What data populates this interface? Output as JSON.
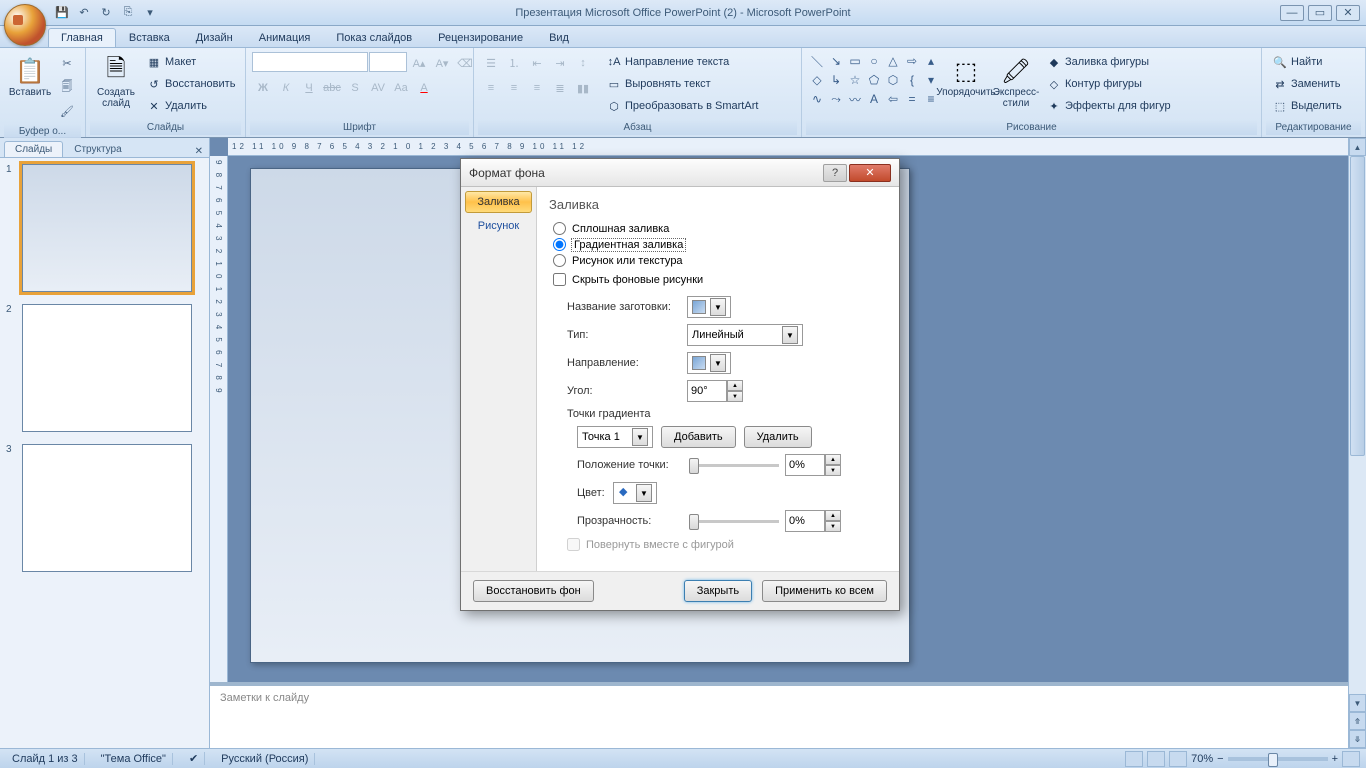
{
  "titlebar": {
    "title": "Презентация Microsoft Office PowerPoint (2) - Microsoft PowerPoint"
  },
  "tabs": {
    "home": "Главная",
    "insert": "Вставка",
    "design": "Дизайн",
    "animation": "Анимация",
    "slideshow": "Показ слайдов",
    "review": "Рецензирование",
    "view": "Вид"
  },
  "ribbon": {
    "clipboard": {
      "label": "Буфер о...",
      "paste": "Вставить"
    },
    "slides": {
      "label": "Слайды",
      "new_slide": "Создать слайд",
      "layout": "Макет",
      "reset": "Восстановить",
      "delete": "Удалить"
    },
    "font": {
      "label": "Шрифт"
    },
    "paragraph": {
      "label": "Абзац",
      "text_dir": "Направление текста",
      "align_text": "Выровнять текст",
      "smartart": "Преобразовать в SmartArt"
    },
    "drawing": {
      "label": "Рисование",
      "arrange": "Упорядочить",
      "quick_styles": "Экспресс-стили",
      "shape_fill": "Заливка фигуры",
      "shape_outline": "Контур фигуры",
      "shape_effects": "Эффекты для фигур"
    },
    "editing": {
      "label": "Редактирование",
      "find": "Найти",
      "replace": "Заменить",
      "select": "Выделить"
    }
  },
  "thumbs": {
    "tab_slides": "Слайды",
    "tab_outline": "Структура"
  },
  "notes": {
    "placeholder": "Заметки к слайду"
  },
  "status": {
    "slide": "Слайд 1 из 3",
    "theme": "\"Тема Office\"",
    "lang": "Русский (Россия)",
    "zoom": "70%"
  },
  "ruler": "12 11 10 9 8 7 6 5 4 3 2 1 0 1 2 3 4 5 6 7 8 9 10 11 12",
  "ruler_v": "9 8 7 6 5 4 3 2 1 0 1 2 3 4 5 6 7 8 9",
  "dialog": {
    "title": "Формат фона",
    "side_fill": "Заливка",
    "side_picture": "Рисунок",
    "heading": "Заливка",
    "solid": "Сплошная заливка",
    "gradient": "Градиентная заливка",
    "picture": "Рисунок или текстура",
    "hide_bg": "Скрыть фоновые рисунки",
    "preset_label": "Название заготовки:",
    "type_label": "Тип:",
    "type_value": "Линейный",
    "direction_label": "Направление:",
    "angle_label": "Угол:",
    "angle_value": "90°",
    "stops_label": "Точки градиента",
    "stop_value": "Точка 1",
    "add_btn": "Добавить",
    "remove_btn": "Удалить",
    "position_label": "Положение точки:",
    "position_value": "0%",
    "color_label": "Цвет:",
    "transparency_label": "Прозрачность:",
    "transparency_value": "0%",
    "rotate_with_shape": "Повернуть вместе с фигурой",
    "reset_bg": "Восстановить фон",
    "close": "Закрыть",
    "apply_all": "Применить ко всем"
  }
}
